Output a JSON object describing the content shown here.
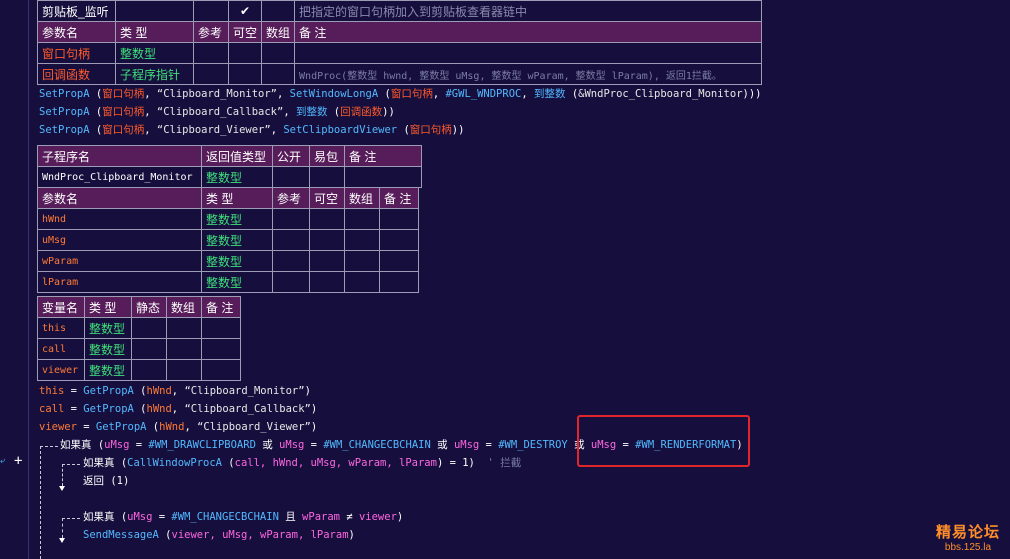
{
  "top_table": {
    "row1": {
      "name": "剪贴板_监听",
      "check": "✔",
      "comment": "把指定的窗口句柄加入到剪贴板查看器链中"
    },
    "headers": [
      "参数名",
      "类 型",
      "参考",
      "可空",
      "数组",
      "备 注"
    ],
    "params": [
      {
        "name": "窗口句柄",
        "type": "整数型",
        "comment": ""
      },
      {
        "name": "回调函数",
        "type": "子程序指针",
        "comment": "WndProc(整数型 hwnd, 整数型 uMsg, 整数型 wParam, 整数型 lParam), 返回1拦截。"
      }
    ]
  },
  "code_lines1": [
    {
      "fn": "SetPropA",
      "a": "窗口句柄",
      "s": "“Clipboard_Monitor”",
      "rest_fn": "SetWindowLongA",
      "a2": "窗口句柄",
      "c": "#GWL_WNDPROC",
      "f2": "到整数",
      "t": "&WndProc_Clipboard_Monitor"
    },
    {
      "fn": "SetPropA",
      "a": "窗口句柄",
      "s": "“Clipboard_Callback”",
      "f2": "到整数",
      "t": "回调函数"
    },
    {
      "fn": "SetPropA",
      "a": "窗口句柄",
      "s": "“Clipboard_Viewer”",
      "rest_fn": "SetClipboardViewer",
      "a2": "窗口句柄"
    }
  ],
  "sub_table": {
    "headers": [
      "子程序名",
      "返回值类型",
      "公开",
      "易包",
      "备 注"
    ],
    "name": "WndProc_Clipboard_Monitor",
    "ret": "整数型",
    "param_headers": [
      "参数名",
      "类 型",
      "参考",
      "可空",
      "数组",
      "备 注"
    ],
    "params": [
      {
        "name": "hWnd",
        "type": "整数型"
      },
      {
        "name": "uMsg",
        "type": "整数型"
      },
      {
        "name": "wParam",
        "type": "整数型"
      },
      {
        "name": "lParam",
        "type": "整数型"
      }
    ]
  },
  "var_table": {
    "headers": [
      "变量名",
      "类 型",
      "静态",
      "数组",
      "备 注"
    ],
    "vars": [
      {
        "name": "this",
        "type": "整数型"
      },
      {
        "name": "call",
        "type": "整数型"
      },
      {
        "name": "viewer",
        "type": "整数型"
      }
    ]
  },
  "code2": {
    "l1": {
      "v": "this",
      "fn": "GetPropA",
      "a": "hWnd",
      "s": "“Clipboard_Monitor”"
    },
    "l2": {
      "v": "call",
      "fn": "GetPropA",
      "a": "hWnd",
      "s": "“Clipboard_Callback”"
    },
    "l3": {
      "v": "viewer",
      "fn": "GetPropA",
      "a": "hWnd",
      "s": "“Clipboard_Viewer”"
    },
    "if1": {
      "kw": "如果真",
      "m": "uMsg",
      "c1": "#WM_DRAWCLIPBOARD",
      "or": "或",
      "c2": "#WM_CHANGECBCHAIN",
      "c3": "#WM_DESTROY",
      "c4": "#WM_RENDERFORMAT"
    },
    "if2": {
      "kw": "如果真",
      "fn": "CallWindowProcA",
      "args": "call, hWnd, uMsg, wParam, lParam",
      "eq": "= 1)",
      "cm": "' 拦截"
    },
    "ret": {
      "kw": "返回",
      "val": "(1)"
    },
    "if3": {
      "kw": "如果真",
      "m": "uMsg",
      "c": "#WM_CHANGECBCHAIN",
      "and": "且",
      "w": "wParam",
      "ne": "≠",
      "v": "viewer"
    },
    "send": {
      "fn": "SendMessageA",
      "args": "viewer, uMsg, wParam, lParam"
    }
  },
  "watermark": {
    "l1": "精易论坛",
    "l2": "bbs.125.la"
  },
  "gutter": {
    "plus": "+"
  }
}
